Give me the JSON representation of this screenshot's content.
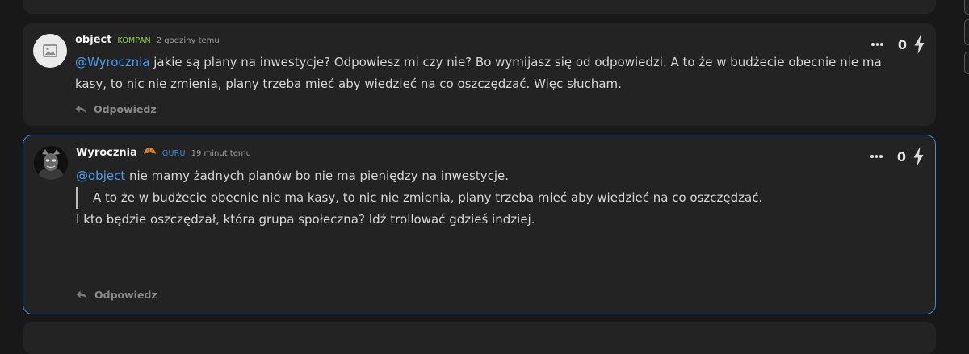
{
  "comments": [
    {
      "author": "object",
      "rank": "KOMPAN",
      "rank_color": "#8fd14f",
      "time": "2 godziny temu",
      "score": "0",
      "mention": "@Wyrocznia",
      "text": " jakie są plany na inwestycje? Odpowiesz mi czy nie? Bo wymijasz się od odpowiedzi. A to że w budżecie obecnie nie ma kasy, to nic nie zmienia, plany trzeba mieć aby wiedzieć na co oszczędzać. Więc słucham.",
      "reply_label": "Odpowiedz"
    },
    {
      "author": "Wyrocznia",
      "rank": "GURU",
      "rank_color": "#3b8be6",
      "time": "19 minut temu",
      "score": "0",
      "mention": "@object",
      "text": " nie mamy żadnych planów bo nie ma pieniędzy na inwestycje.",
      "quote": "A to że w budżecie obecnie nie ma kasy, to nic nie zmienia, plany trzeba mieć aby wiedzieć na co oszczędzać.",
      "text2": "I kto będzie oszczędzał, która grupa społeczna? Idź trollować gdzieś indziej.",
      "reply_label": "Odpowiedz",
      "highlight_color": "#3b8be6"
    }
  ],
  "icons": {
    "avatar_1": "image-placeholder-icon",
    "avatar_2": "user-avatar-photo",
    "badge": "croissant-icon",
    "more": "more-dots-icon",
    "vote": "lightning-icon",
    "reply": "reply-arrow-icon"
  },
  "colors": {
    "mention": "#4a9bf0",
    "background": "#181818",
    "card": "#232323"
  }
}
